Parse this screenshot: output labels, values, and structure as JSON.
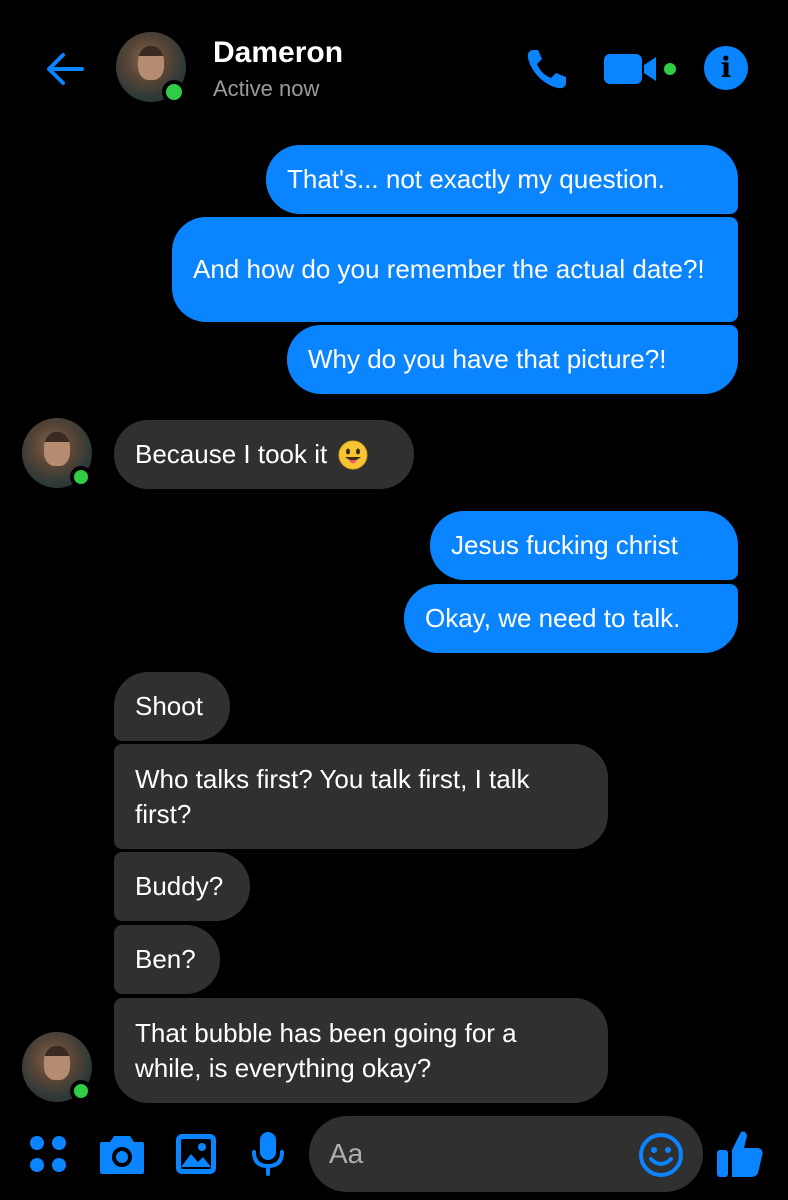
{
  "header": {
    "contact_name": "Dameron",
    "status": "Active now",
    "icons": [
      "back-arrow-icon",
      "phone-icon",
      "video-camera-icon",
      "info-icon"
    ]
  },
  "messages": [
    {
      "from": "me",
      "text": "That's... not exactly my question."
    },
    {
      "from": "me",
      "text": "And how do you remember the actual date?!"
    },
    {
      "from": "me",
      "text": "Why do you have that picture?!"
    },
    {
      "from": "them",
      "text": "Because I took it",
      "emoji": "grinning-face-with-tongue"
    },
    {
      "from": "me",
      "text": "Jesus fucking christ"
    },
    {
      "from": "me",
      "text": "Okay, we need to talk."
    },
    {
      "from": "them",
      "text": "Shoot"
    },
    {
      "from": "them",
      "text": "Who talks first? You talk first, I talk first?"
    },
    {
      "from": "them",
      "text": "Buddy?"
    },
    {
      "from": "them",
      "text": "Ben?"
    },
    {
      "from": "them",
      "text": "That bubble has been going for a while, is everything okay?"
    }
  ],
  "composer": {
    "placeholder": "Aa",
    "icons": [
      "apps-grid-icon",
      "camera-icon",
      "gallery-icon",
      "microphone-icon",
      "emoji-icon",
      "thumbs-up-icon"
    ]
  },
  "colors": {
    "accent": "#0a84ff",
    "background": "#000000",
    "received_bubble": "#303030",
    "online": "#31cc46"
  }
}
